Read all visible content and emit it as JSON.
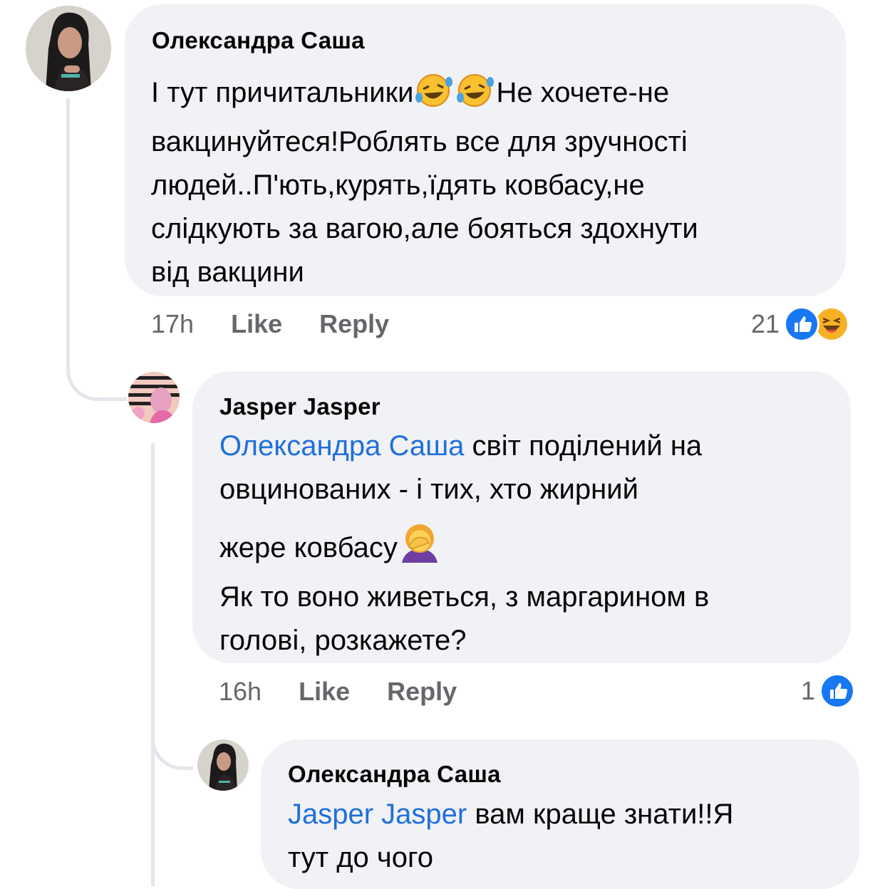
{
  "comments": [
    {
      "author": "Олександра Саша",
      "lines": [
        "І тут причитальники",
        "Не хочете-не",
        "вакцинуйтеся!Роблять все для зручності",
        "людей..П'ють,курять,їдять ковбасу,не",
        "слідкують за вагою,але бояться здохнути",
        "від вакцини"
      ],
      "time": "17h",
      "like_label": "Like",
      "reply_label": "Reply",
      "reaction_count": "21",
      "reaction_icons": [
        "like-icon",
        "haha-icon"
      ]
    },
    {
      "author": "Jasper Jasper",
      "mention": "Олександра Саша",
      "lines": [
        "світ поділений на",
        "овцинованих - і тих, хто жирний",
        "жере ковбасу",
        "Як то воно живеться, з маргарином в",
        "голові, розкажете?"
      ],
      "time": "16h",
      "like_label": "Like",
      "reply_label": "Reply",
      "reaction_count": "1",
      "reaction_icons": [
        "like-icon"
      ]
    },
    {
      "author": "Олександра Саша",
      "mention": "Jasper Jasper",
      "lines": [
        "вам краще знати!!Я",
        "тут до чого"
      ]
    }
  ],
  "colors": {
    "bubble": "#f0f2f5",
    "mention": "#216fdb",
    "meta": "#65676b",
    "like_blue": "#1877f2",
    "haha_yellow": "#f7b125"
  }
}
